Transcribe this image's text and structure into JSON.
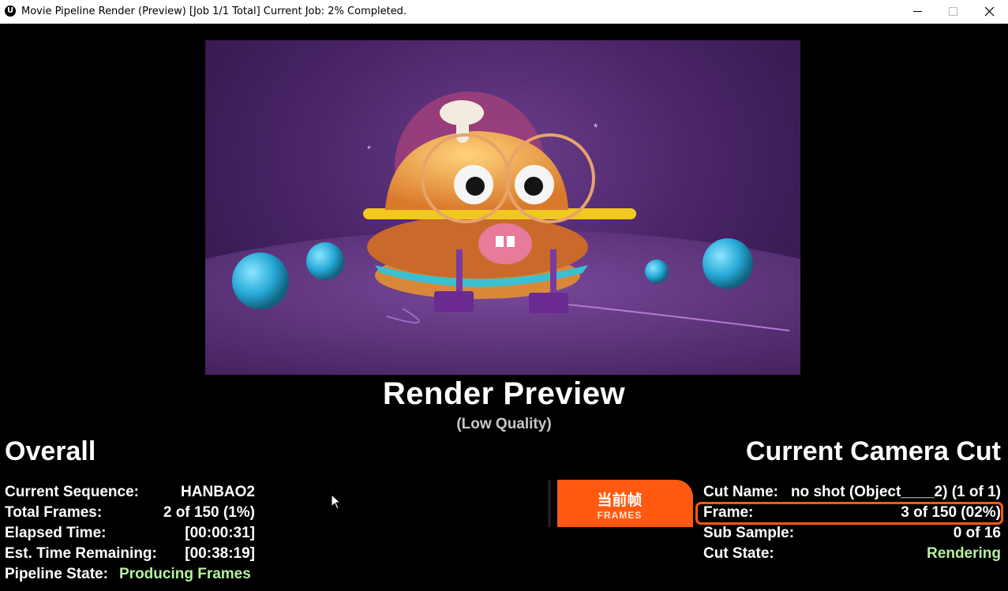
{
  "window": {
    "title": "Movie Pipeline Render (Preview) [Job 1/1 Total] Current Job: 2% Completed.",
    "icon": "unreal-logo-icon"
  },
  "preview": {
    "title": "Render Preview",
    "subtitle": "(Low Quality)"
  },
  "overall": {
    "heading": "Overall",
    "rows": [
      {
        "label": "Current Sequence:",
        "value": "HANBAO2"
      },
      {
        "label": "Total Frames:",
        "value": "2 of 150 (1%)"
      },
      {
        "label": "Elapsed Time:",
        "value": "[00:00:31]"
      },
      {
        "label": "Est. Time Remaining:",
        "value": "[00:38:19]"
      },
      {
        "label": "Pipeline State:",
        "value": "Producing Frames"
      }
    ]
  },
  "camera_cut": {
    "heading": "Current Camera Cut",
    "rows": [
      {
        "label": "Cut Name:",
        "value": "no shot (Object____2) (1 of 1)"
      },
      {
        "label": "Frame:",
        "value": "3 of 150 (02%)"
      },
      {
        "label": "Sub Sample:",
        "value": "0 of 16"
      },
      {
        "label": "Cut State:",
        "value": "Rendering"
      }
    ]
  },
  "overlay_badge": {
    "cn": "当前帧",
    "en": "FRAMES"
  },
  "colors": {
    "state_green": "#b6f0a0",
    "highlight_orange": "#ff5a12"
  }
}
